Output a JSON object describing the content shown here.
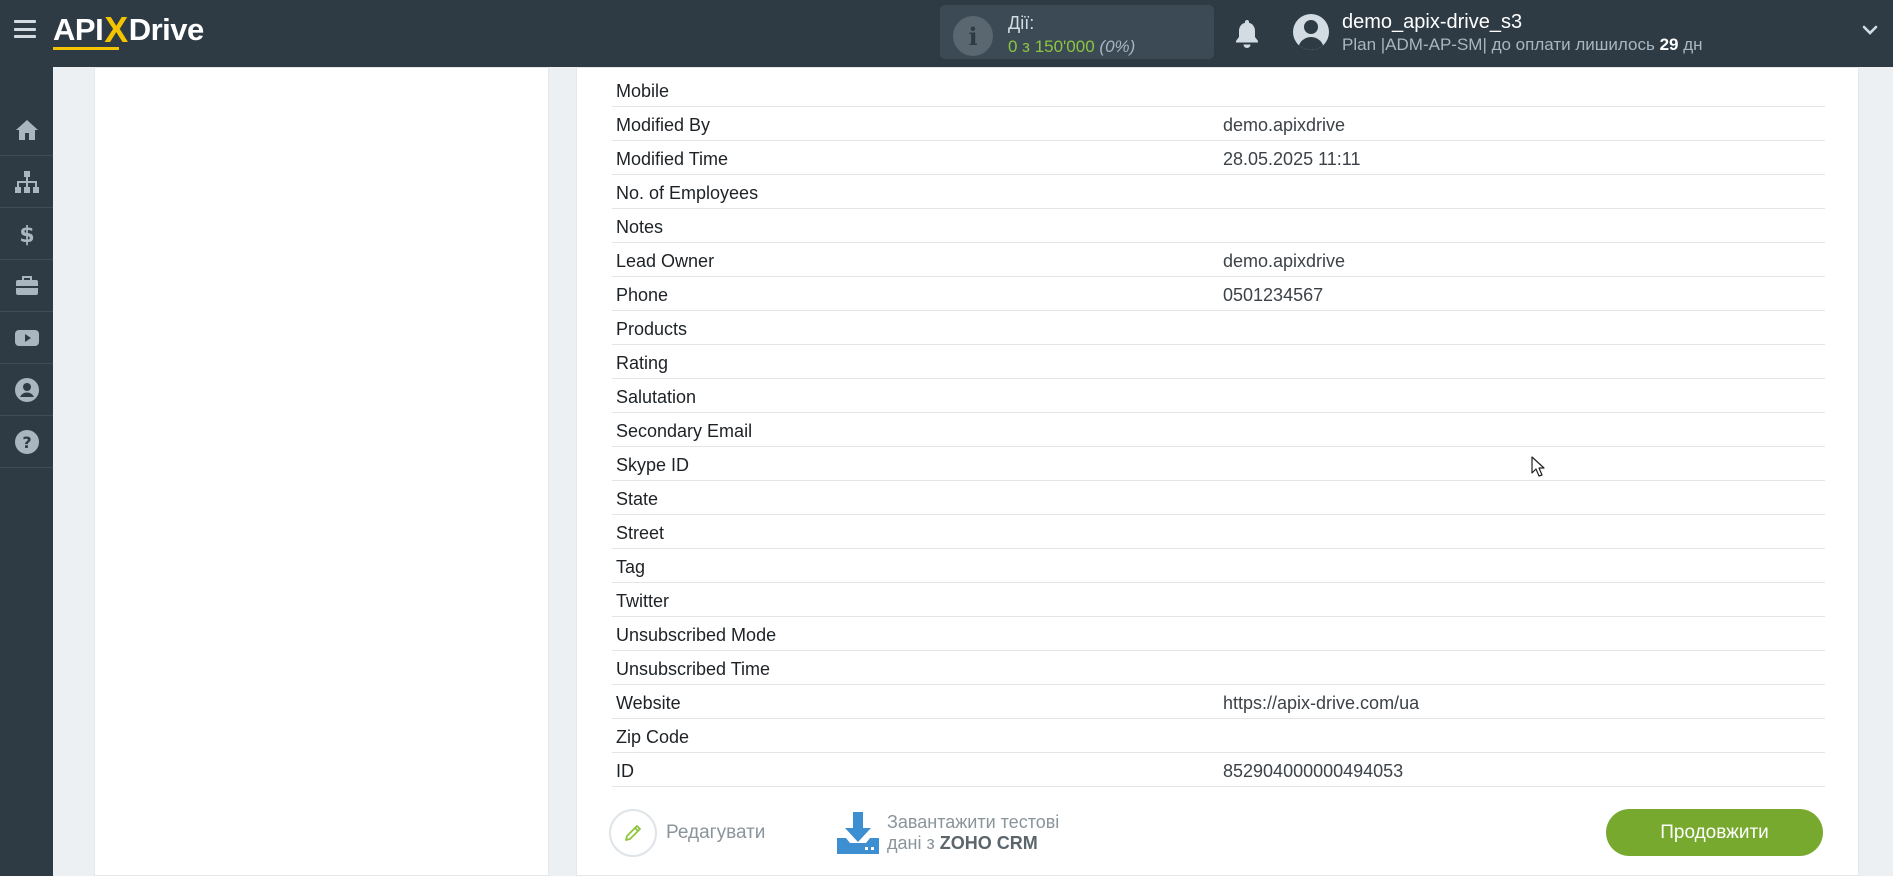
{
  "header": {
    "logo_left": "API",
    "logo_x": "X",
    "logo_right": "Drive",
    "actions_label": "Дії:",
    "actions_count": "0 з 150'000",
    "actions_percent": "(0%)",
    "user_name": "demo_apix-drive_s3",
    "plan_text": "Plan |ADM-AP-SM| до оплати лишилось",
    "plan_days": "29",
    "plan_days_unit": "дн"
  },
  "sidebar": {
    "items": [
      {
        "icon": "home-icon"
      },
      {
        "icon": "sitemap-icon"
      },
      {
        "icon": "dollar-icon"
      },
      {
        "icon": "briefcase-icon"
      },
      {
        "icon": "youtube-icon"
      },
      {
        "icon": "user-circle-icon"
      },
      {
        "icon": "help-icon"
      }
    ]
  },
  "fields": [
    {
      "key": "Mobile",
      "value": ""
    },
    {
      "key": "Modified By",
      "value": "demo.apixdrive"
    },
    {
      "key": "Modified Time",
      "value": "28.05.2025 11:11"
    },
    {
      "key": "No. of Employees",
      "value": ""
    },
    {
      "key": "Notes",
      "value": ""
    },
    {
      "key": "Lead Owner",
      "value": "demo.apixdrive"
    },
    {
      "key": "Phone",
      "value": "0501234567"
    },
    {
      "key": "Products",
      "value": ""
    },
    {
      "key": "Rating",
      "value": ""
    },
    {
      "key": "Salutation",
      "value": ""
    },
    {
      "key": "Secondary Email",
      "value": ""
    },
    {
      "key": "Skype ID",
      "value": ""
    },
    {
      "key": "State",
      "value": ""
    },
    {
      "key": "Street",
      "value": ""
    },
    {
      "key": "Tag",
      "value": ""
    },
    {
      "key": "Twitter",
      "value": ""
    },
    {
      "key": "Unsubscribed Mode",
      "value": ""
    },
    {
      "key": "Unsubscribed Time",
      "value": ""
    },
    {
      "key": "Website",
      "value": "https://apix-drive.com/ua"
    },
    {
      "key": "Zip Code",
      "value": ""
    },
    {
      "key": "ID",
      "value": "852904000000494053"
    }
  ],
  "footer": {
    "edit_label": "Редагувати",
    "download_line1": "Завантажити тестові",
    "download_line2_prefix": "дані з",
    "download_line2_brand": "ZOHO CRM",
    "continue_label": "Продовжити"
  },
  "colors": {
    "topbar": "#2e3b45",
    "accent_green": "#78a92f",
    "logo_yellow": "#f5c400",
    "download_blue": "#3d8fd1"
  }
}
